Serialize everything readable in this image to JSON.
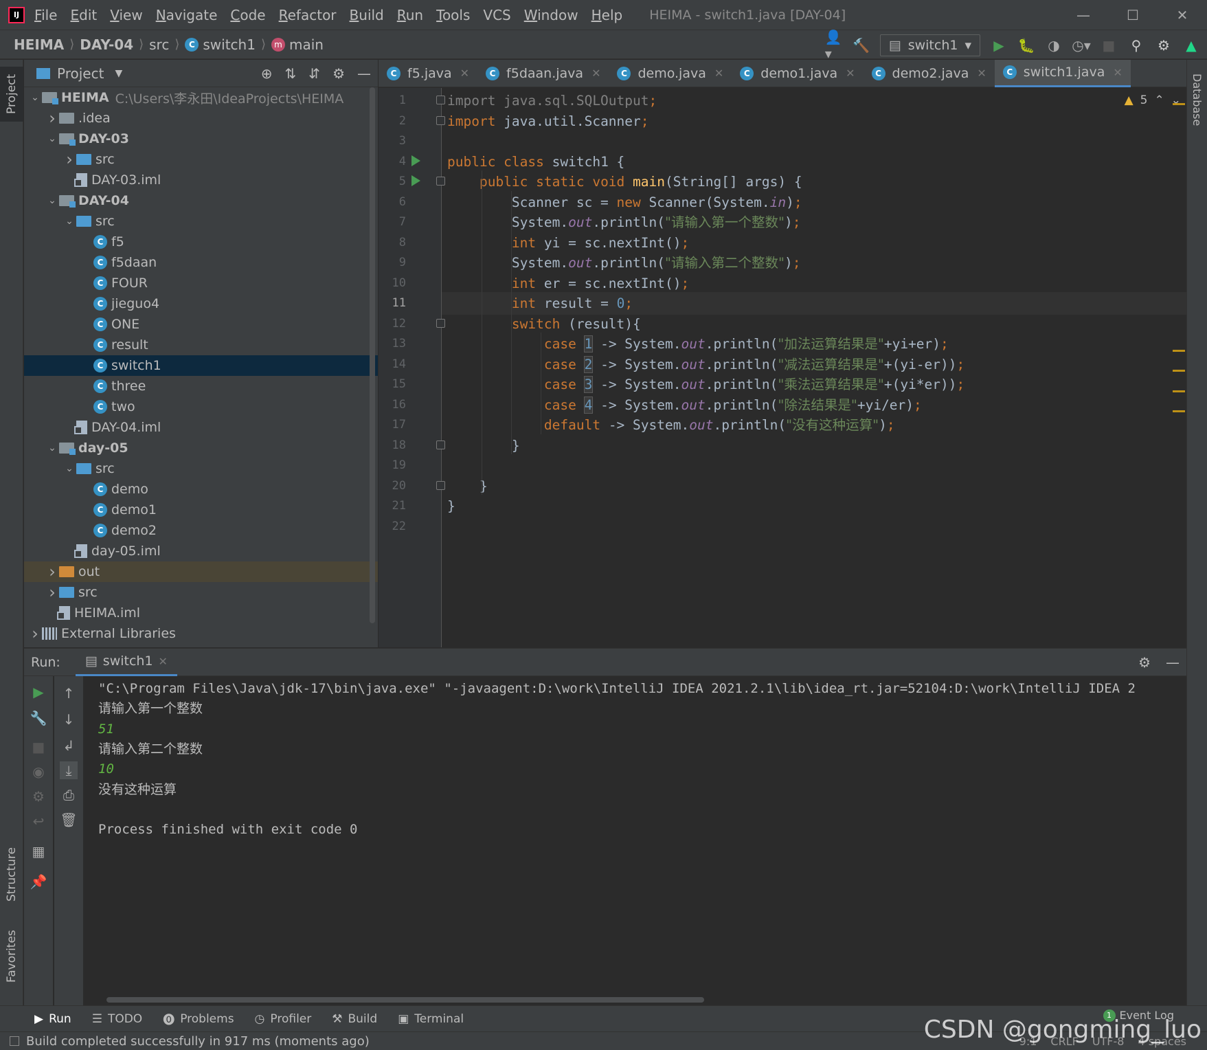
{
  "menubar": {
    "items": [
      {
        "u": "F",
        "rest": "ile"
      },
      {
        "u": "E",
        "rest": "dit"
      },
      {
        "u": "V",
        "rest": "iew"
      },
      {
        "u": "N",
        "rest": "avigate"
      },
      {
        "u": "C",
        "rest": "ode"
      },
      {
        "u": "R",
        "rest": "efactor"
      },
      {
        "u": "B",
        "rest": "uild"
      },
      {
        "u": "R",
        "rest": "un"
      },
      {
        "u": "T",
        "rest": "ools"
      },
      {
        "u": "",
        "rest": "VCS"
      },
      {
        "u": "W",
        "rest": "indow"
      },
      {
        "u": "H",
        "rest": "elp"
      }
    ],
    "window_title": "HEIMA - switch1.java [DAY-04]"
  },
  "navbar": {
    "breadcrumbs": [
      "HEIMA",
      "DAY-04",
      "src",
      "switch1",
      "main"
    ],
    "run_config": "switch1"
  },
  "project_panel": {
    "title": "Project",
    "tree": [
      {
        "indent": 0,
        "arrow": "v",
        "icon": "module",
        "label": "HEIMA",
        "bold": true,
        "hint": "C:\\Users\\李永田\\IdeaProjects\\HEIMA"
      },
      {
        "indent": 1,
        "arrow": ">",
        "icon": "folder",
        "label": ".idea"
      },
      {
        "indent": 1,
        "arrow": "v",
        "icon": "module",
        "label": "DAY-03",
        "bold": true
      },
      {
        "indent": 2,
        "arrow": ">",
        "icon": "src",
        "label": "src"
      },
      {
        "indent": 2,
        "arrow": "",
        "icon": "iml",
        "label": "DAY-03.iml"
      },
      {
        "indent": 1,
        "arrow": "v",
        "icon": "module",
        "label": "DAY-04",
        "bold": true
      },
      {
        "indent": 2,
        "arrow": "v",
        "icon": "src",
        "label": "src"
      },
      {
        "indent": 3,
        "arrow": "",
        "icon": "class",
        "label": "f5"
      },
      {
        "indent": 3,
        "arrow": "",
        "icon": "class",
        "label": "f5daan"
      },
      {
        "indent": 3,
        "arrow": "",
        "icon": "class",
        "label": "FOUR"
      },
      {
        "indent": 3,
        "arrow": "",
        "icon": "class",
        "label": "jieguo4"
      },
      {
        "indent": 3,
        "arrow": "",
        "icon": "class",
        "label": "ONE"
      },
      {
        "indent": 3,
        "arrow": "",
        "icon": "class",
        "label": "result"
      },
      {
        "indent": 3,
        "arrow": "",
        "icon": "class",
        "label": "switch1",
        "selected": true
      },
      {
        "indent": 3,
        "arrow": "",
        "icon": "class",
        "label": "three"
      },
      {
        "indent": 3,
        "arrow": "",
        "icon": "class",
        "label": "two"
      },
      {
        "indent": 2,
        "arrow": "",
        "icon": "iml",
        "label": "DAY-04.iml"
      },
      {
        "indent": 1,
        "arrow": "v",
        "icon": "module",
        "label": "day-05",
        "bold": true
      },
      {
        "indent": 2,
        "arrow": "v",
        "icon": "src",
        "label": "src"
      },
      {
        "indent": 3,
        "arrow": "",
        "icon": "class",
        "label": "demo"
      },
      {
        "indent": 3,
        "arrow": "",
        "icon": "class",
        "label": "demo1"
      },
      {
        "indent": 3,
        "arrow": "",
        "icon": "class",
        "label": "demo2"
      },
      {
        "indent": 2,
        "arrow": "",
        "icon": "iml",
        "label": "day-05.iml"
      },
      {
        "indent": 1,
        "arrow": ">",
        "icon": "out",
        "label": "out",
        "excluded": true
      },
      {
        "indent": 1,
        "arrow": ">",
        "icon": "src",
        "label": "src"
      },
      {
        "indent": 1,
        "arrow": "",
        "icon": "iml",
        "label": "HEIMA.iml"
      },
      {
        "indent": 0,
        "arrow": ">",
        "icon": "lib",
        "label": "External Libraries"
      }
    ]
  },
  "editor_tabs": [
    {
      "label": "f5.java",
      "active": false
    },
    {
      "label": "f5daan.java",
      "active": false
    },
    {
      "label": "demo.java",
      "active": false
    },
    {
      "label": "demo1.java",
      "active": false
    },
    {
      "label": "demo2.java",
      "active": false
    },
    {
      "label": "switch1.java",
      "active": true
    }
  ],
  "editor": {
    "warning_count": "5",
    "current_line": 11,
    "code_lines": [
      [
        [
          "imp",
          "import java.sql.SQLOutput"
        ],
        [
          "kw",
          ";"
        ]
      ],
      [
        [
          "kw",
          "import "
        ],
        [
          "p",
          "java.util.Scanner"
        ],
        [
          "kw",
          ";"
        ]
      ],
      [],
      [
        [
          "kw",
          "public class "
        ],
        [
          "p",
          "switch1 {"
        ]
      ],
      [
        [
          "p",
          "    "
        ],
        [
          "kw",
          "public static void "
        ],
        [
          "mth",
          "main"
        ],
        [
          "p",
          "(String[] args) {"
        ]
      ],
      [
        [
          "p",
          "        Scanner sc = "
        ],
        [
          "kw",
          "new "
        ],
        [
          "p",
          "Scanner(System."
        ],
        [
          "fld",
          "in"
        ],
        [
          "p",
          ")"
        ],
        [
          "kw",
          ";"
        ]
      ],
      [
        [
          "p",
          "        System."
        ],
        [
          "fld",
          "out"
        ],
        [
          "p",
          ".println("
        ],
        [
          "str",
          "\"请输入第一个整数\""
        ],
        [
          "p",
          ")"
        ],
        [
          "kw",
          ";"
        ]
      ],
      [
        [
          "p",
          "        "
        ],
        [
          "kw",
          "int "
        ],
        [
          "p",
          "yi = sc.nextInt()"
        ],
        [
          "kw",
          ";"
        ]
      ],
      [
        [
          "p",
          "        System."
        ],
        [
          "fld",
          "out"
        ],
        [
          "p",
          ".println("
        ],
        [
          "str",
          "\"请输入第二个整数\""
        ],
        [
          "p",
          ")"
        ],
        [
          "kw",
          ";"
        ]
      ],
      [
        [
          "p",
          "        "
        ],
        [
          "kw",
          "int "
        ],
        [
          "p",
          "er = sc.nextInt()"
        ],
        [
          "kw",
          ";"
        ]
      ],
      [
        [
          "p",
          "        "
        ],
        [
          "kw",
          "int "
        ],
        [
          "p",
          "result = "
        ],
        [
          "num",
          "0"
        ],
        [
          "kw",
          ";"
        ]
      ],
      [
        [
          "p",
          "        "
        ],
        [
          "kw",
          "switch "
        ],
        [
          "p",
          "(result){"
        ]
      ],
      [
        [
          "p",
          "            "
        ],
        [
          "kw",
          "case "
        ],
        [
          "numbox",
          "1"
        ],
        [
          "p",
          " -> System."
        ],
        [
          "fld",
          "out"
        ],
        [
          "p",
          ".println("
        ],
        [
          "str",
          "\"加法运算结果是\""
        ],
        [
          "p",
          "+yi+er)"
        ],
        [
          "kw",
          ";"
        ]
      ],
      [
        [
          "p",
          "            "
        ],
        [
          "kw",
          "case "
        ],
        [
          "numbox",
          "2"
        ],
        [
          "p",
          " -> System."
        ],
        [
          "fld",
          "out"
        ],
        [
          "p",
          ".println("
        ],
        [
          "str",
          "\"减法运算结果是\""
        ],
        [
          "p",
          "+(yi-er))"
        ],
        [
          "kw",
          ";"
        ]
      ],
      [
        [
          "p",
          "            "
        ],
        [
          "kw",
          "case "
        ],
        [
          "numbox",
          "3"
        ],
        [
          "p",
          " -> System."
        ],
        [
          "fld",
          "out"
        ],
        [
          "p",
          ".println("
        ],
        [
          "str",
          "\"乘法运算结果是\""
        ],
        [
          "p",
          "+(yi*er))"
        ],
        [
          "kw",
          ";"
        ]
      ],
      [
        [
          "p",
          "            "
        ],
        [
          "kw",
          "case "
        ],
        [
          "numbox",
          "4"
        ],
        [
          "p",
          " -> System."
        ],
        [
          "fld",
          "out"
        ],
        [
          "p",
          ".println("
        ],
        [
          "str",
          "\"除法结果是\""
        ],
        [
          "p",
          "+yi/er)"
        ],
        [
          "kw",
          ";"
        ]
      ],
      [
        [
          "p",
          "            "
        ],
        [
          "kw",
          "default "
        ],
        [
          "p",
          "-> System."
        ],
        [
          "fld",
          "out"
        ],
        [
          "p",
          ".println("
        ],
        [
          "str",
          "\"没有这种运算\""
        ],
        [
          "p",
          ")"
        ],
        [
          "kw",
          ";"
        ]
      ],
      [
        [
          "p",
          "        }"
        ]
      ],
      [],
      [
        [
          "p",
          "    }"
        ]
      ],
      [
        [
          "p",
          "}"
        ]
      ],
      []
    ]
  },
  "run_panel": {
    "label": "Run:",
    "tab": "switch1",
    "console": [
      {
        "type": "out",
        "text": "\"C:\\Program Files\\Java\\jdk-17\\bin\\java.exe\" \"-javaagent:D:\\work\\IntelliJ IDEA 2021.2.1\\lib\\idea_rt.jar=52104:D:\\work\\IntelliJ IDEA 2"
      },
      {
        "type": "out",
        "text": "请输入第一个整数"
      },
      {
        "type": "input",
        "text": "51"
      },
      {
        "type": "out",
        "text": "请输入第二个整数"
      },
      {
        "type": "input",
        "text": "10"
      },
      {
        "type": "out",
        "text": "没有这种运算"
      },
      {
        "type": "out",
        "text": ""
      },
      {
        "type": "out",
        "text": "Process finished with exit code 0"
      }
    ]
  },
  "bottom_tabs": [
    "Run",
    "TODO",
    "Problems",
    "Profiler",
    "Build",
    "Terminal"
  ],
  "left_stripe": {
    "project": "Project",
    "structure": "Structure",
    "favorites": "Favorites"
  },
  "right_stripe": {
    "database": "Database"
  },
  "event_log": {
    "count": "1",
    "label": "Event Log"
  },
  "statusbar": {
    "message": "Build completed successfully in 917 ms (moments ago)",
    "position": "9:1",
    "line_sep": "CRLF",
    "encoding": "UTF-8",
    "indent": "4 spaces"
  },
  "watermark": "CSDN @gongming_luo"
}
